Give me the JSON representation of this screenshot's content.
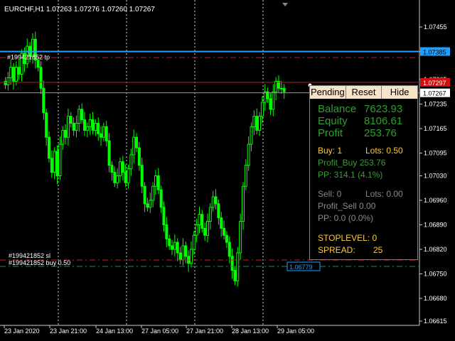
{
  "window": {
    "title": "EURCHF,H1  1.07263 1.07276 1.07260 1.07267"
  },
  "chart_data": {
    "type": "candlestick",
    "symbol": "EURCHF",
    "timeframe": "H1",
    "ohlc_header": [
      "1.07263",
      "1.07276",
      "1.07260",
      "1.07267"
    ],
    "price_ticks": [
      "1.07455",
      "1.07385",
      "1.07305",
      "1.07235",
      "1.07165",
      "1.07095",
      "1.07030",
      "1.06960",
      "1.06890",
      "1.06820",
      "1.06750",
      "1.06680",
      "1.06615"
    ],
    "time_ticks": [
      "23 Jan 2020",
      "23 Jan 21:00",
      "24 Jan 13:00",
      "27 Jan 05:00",
      "27 Jan 21:00",
      "28 Jan 13:00",
      "29 Jan 05:00"
    ],
    "price_labels": {
      "tp": "1.07385",
      "bid": "1.07267",
      "ask": "1.07297",
      "entry": "1.06779"
    },
    "line_labels": {
      "tp": "#199421852 tp",
      "sl": "#199421852 sl",
      "buy": "#199421852 buy 0.50"
    },
    "closes": [
      1.0729,
      1.0731,
      1.0734,
      1.073,
      1.0734,
      1.0732,
      1.0738,
      1.0735,
      1.074,
      1.0737,
      1.0742,
      1.0736,
      1.0734,
      1.0728,
      1.0721,
      1.0714,
      1.0708,
      1.0704,
      1.071,
      1.0703,
      1.0712,
      1.0716,
      1.0714,
      1.072,
      1.0718,
      1.0716,
      1.0718,
      1.0722,
      1.0719,
      1.0716,
      1.0717,
      1.0719,
      1.0716,
      1.0718,
      1.0715,
      1.0714,
      1.0717,
      1.0713,
      1.0706,
      1.0704,
      1.0701,
      1.0703,
      1.0707,
      1.0704,
      1.0701,
      1.0705,
      1.0709,
      1.0714,
      1.0711,
      1.0706,
      1.07,
      1.0695,
      1.0694,
      1.0696,
      1.07,
      1.0703,
      1.0699,
      1.0694,
      1.0689,
      1.0685,
      1.0683,
      1.0682,
      1.0684,
      1.0681,
      1.0679,
      1.0683,
      1.068,
      1.0678,
      1.0682,
      1.0686,
      1.0689,
      1.0692,
      1.0688,
      1.0686,
      1.069,
      1.0694,
      1.0697,
      1.0695,
      1.0691,
      1.0688,
      1.0686,
      1.0684,
      1.068,
      1.0676,
      1.0673,
      1.0681,
      1.069,
      1.07,
      1.0706,
      1.0712,
      1.0717,
      1.072,
      1.0716,
      1.072,
      1.0724,
      1.0727,
      1.0725,
      1.0722,
      1.0727,
      1.073,
      1.0728,
      1.0728,
      1.0727
    ]
  },
  "buttons": {
    "pending": "Pending",
    "reset": "Reset",
    "hide": "Hide"
  },
  "panel": {
    "balance_label": "Balance",
    "balance_value": "7623.93",
    "equity_label": "Equity",
    "equity_value": "8106.61",
    "profit_label": "Profit",
    "profit_value": "253.76",
    "buy_label": "Buy: 1",
    "buy_lots": "Lots: 0.50",
    "profit_buy": "Profit_Buy 253.76",
    "pp_buy": "PP: 314.1  (4.1%)",
    "sell_label": "Sell: 0",
    "sell_lots": "Lots: 0.00",
    "profit_sell": "Profit_Sell 0.00",
    "pp_sell": "PP: 0.0  (0.0%)",
    "stoplevel": "STOPLEVEL: 0",
    "spread_label": "SPREAD:",
    "spread_value": "25"
  },
  "colors": {
    "candle": "#00ff00",
    "tp_line": "#1ea0ff",
    "ask_line": "#d01010",
    "dash": "#c02020",
    "entry_dash": "#1a8a5a"
  }
}
